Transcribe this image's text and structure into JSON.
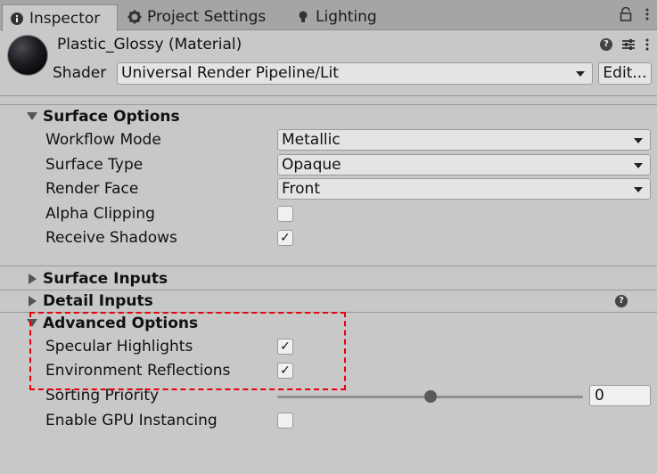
{
  "tabs": [
    {
      "label": "Inspector",
      "icon": "info-icon"
    },
    {
      "label": "Project Settings",
      "icon": "gear-icon"
    },
    {
      "label": "Lighting",
      "icon": "lightbulb-icon"
    }
  ],
  "header": {
    "title": "Plastic_Glossy (Material)",
    "shader_label": "Shader",
    "shader_value": "Universal Render Pipeline/Lit",
    "edit_label": "Edit..."
  },
  "surface_options": {
    "title": "Surface Options",
    "workflow_mode": {
      "label": "Workflow Mode",
      "value": "Metallic"
    },
    "surface_type": {
      "label": "Surface Type",
      "value": "Opaque"
    },
    "render_face": {
      "label": "Render Face",
      "value": "Front"
    },
    "alpha_clipping": {
      "label": "Alpha Clipping",
      "checked": false
    },
    "receive_shadows": {
      "label": "Receive Shadows",
      "checked": true,
      "mark": "✓"
    }
  },
  "surface_inputs": {
    "title": "Surface Inputs"
  },
  "detail_inputs": {
    "title": "Detail Inputs"
  },
  "advanced_options": {
    "title": "Advanced Options",
    "specular_highlights": {
      "label": "Specular Highlights",
      "checked": true,
      "mark": "✓"
    },
    "environment_reflections": {
      "label": "Environment Reflections",
      "checked": true,
      "mark": "✓"
    },
    "sorting_priority": {
      "label": "Sorting Priority",
      "value": "0",
      "slider_fraction": 0.5
    },
    "gpu_instancing": {
      "label": "Enable GPU Instancing",
      "checked": false
    }
  },
  "colors": {
    "highlight_border": "#e8000b",
    "panel_bg": "#c8c8c8",
    "tabbar_bg": "#a5a5a5"
  }
}
